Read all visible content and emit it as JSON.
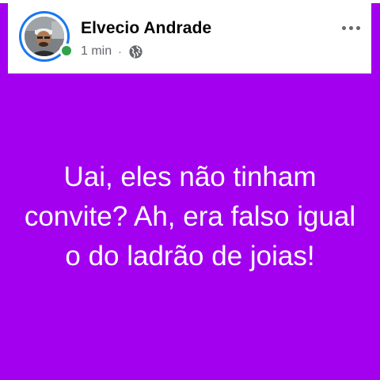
{
  "post": {
    "author_name": "Elvecio Andrade",
    "timestamp": "1 min",
    "separator": "·",
    "privacy_icon": "globe-icon",
    "more_icon": "more-horizontal-icon",
    "text": "Uai, eles não tinham convite? Ah, era falso igual o do ladrão de joias!"
  },
  "colors": {
    "background": "#a300f0",
    "text": "#ffffff",
    "story_ring": "#1877f2",
    "online": "#31a24c",
    "meta_text": "#65676b"
  }
}
